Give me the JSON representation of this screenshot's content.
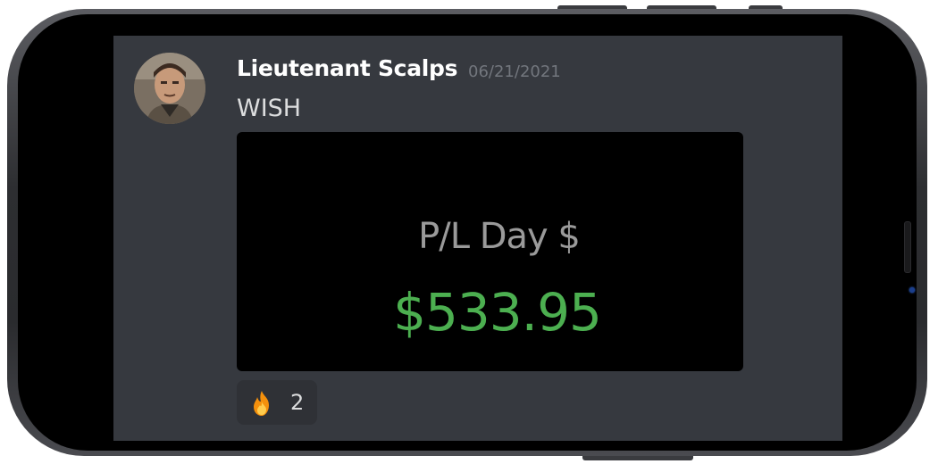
{
  "message": {
    "author": "Lieutenant Scalps",
    "timestamp": "06/21/2021",
    "text": "WISH",
    "avatar_icon": "user-avatar"
  },
  "attachment": {
    "label": "P/L Day $",
    "value": "$533.95",
    "label_color": "#9a9a9a",
    "value_color": "#4caf50"
  },
  "reactions": [
    {
      "emoji_icon": "fire-icon",
      "count": "2"
    }
  ],
  "theme": {
    "background": "#36393f",
    "author_color": "#ffffff",
    "timestamp_color": "#72767d",
    "reaction_bg": "#2f3136"
  }
}
